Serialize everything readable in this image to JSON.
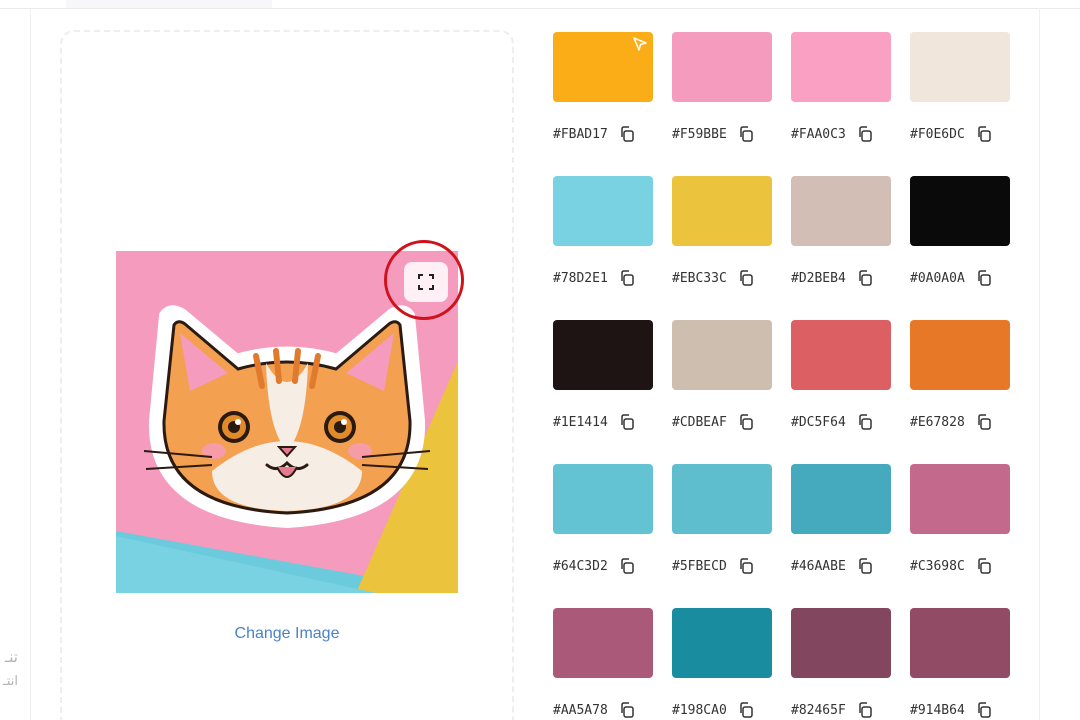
{
  "side_text": {
    "line1": "تنـ",
    "line2": "انتـ"
  },
  "image_panel": {
    "change_image_label": "Change Image",
    "expand_icon": "expand-icon"
  },
  "palette": [
    {
      "hex": "#FBAD17",
      "color": "#FBAD17"
    },
    {
      "hex": "#F59BBE",
      "color": "#F59BBE"
    },
    {
      "hex": "#FAA0C3",
      "color": "#FAA0C3"
    },
    {
      "hex": "#F0E6DC",
      "color": "#F0E6DC"
    },
    {
      "hex": "#78D2E1",
      "color": "#78D2E1"
    },
    {
      "hex": "#EBC33C",
      "color": "#EBC33C"
    },
    {
      "hex": "#D2BEB4",
      "color": "#D2BEB4"
    },
    {
      "hex": "#0A0A0A",
      "color": "#0A0A0A"
    },
    {
      "hex": "#1E1414",
      "color": "#1E1414"
    },
    {
      "hex": "#CDBEAF",
      "color": "#CDBEAF"
    },
    {
      "hex": "#DC5F64",
      "color": "#DC5F64"
    },
    {
      "hex": "#E67828",
      "color": "#E67828"
    },
    {
      "hex": "#64C3D2",
      "color": "#64C3D2"
    },
    {
      "hex": "#5FBECD",
      "color": "#5FBECD"
    },
    {
      "hex": "#46AABE",
      "color": "#46AABE"
    },
    {
      "hex": "#C3698C",
      "color": "#C3698C"
    },
    {
      "hex": "#AA5A78",
      "color": "#AA5A78"
    },
    {
      "hex": "#198CA0",
      "color": "#198CA0"
    },
    {
      "hex": "#82465F",
      "color": "#82465F"
    },
    {
      "hex": "#914B64",
      "color": "#914B64"
    }
  ],
  "colors": {
    "link": "#4A82C8",
    "highlight_circle": "#D0121D"
  }
}
